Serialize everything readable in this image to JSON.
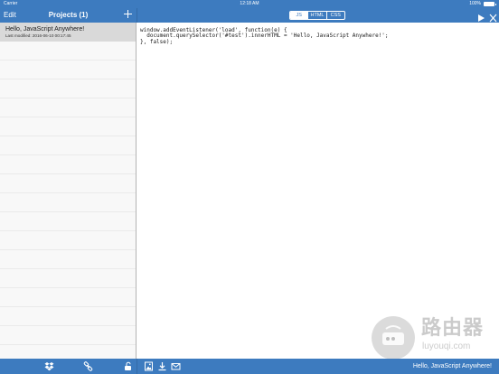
{
  "status_bar": {
    "carrier": "Carrier",
    "time": "12:18 AM",
    "battery_text": "100%",
    "battery_level": 1.0
  },
  "nav": {
    "edit_label": "Edit",
    "projects_title": "Projects (1)",
    "add_icon": "plus-icon",
    "tabs": [
      {
        "label": "JS",
        "active": true
      },
      {
        "label": "HTML",
        "active": false
      },
      {
        "label": "CSS",
        "active": false
      }
    ],
    "run_icon": "play-icon",
    "close_icon": "close-icon"
  },
  "sidebar": {
    "projects": [
      {
        "name": "Hello, JavaScript Anywhere!",
        "modified": "Last modified: 2016-06-10 00:17:45"
      }
    ]
  },
  "editor": {
    "language": "JS",
    "code_lines": [
      "window.addEventListener('load', function(e) {",
      "  document.querySelector('#test').innerHTML = 'Hello, JavaScript Anywhere!';",
      "}, false);"
    ]
  },
  "watermark": {
    "title": "路由器",
    "subtitle": "luyouqi.com",
    "icon": "router-icon"
  },
  "bottom_bar": {
    "icons": [
      "dropbox-icon",
      "link-icon",
      "unlock-icon",
      "image-icon",
      "download-icon",
      "mail-icon"
    ],
    "status": "Hello, JavaScript Anywhere!"
  },
  "colors": {
    "bar": "#3d7bbf",
    "selected_row": "#d9d9d9",
    "sidebar_bg": "#f8f8f8"
  }
}
